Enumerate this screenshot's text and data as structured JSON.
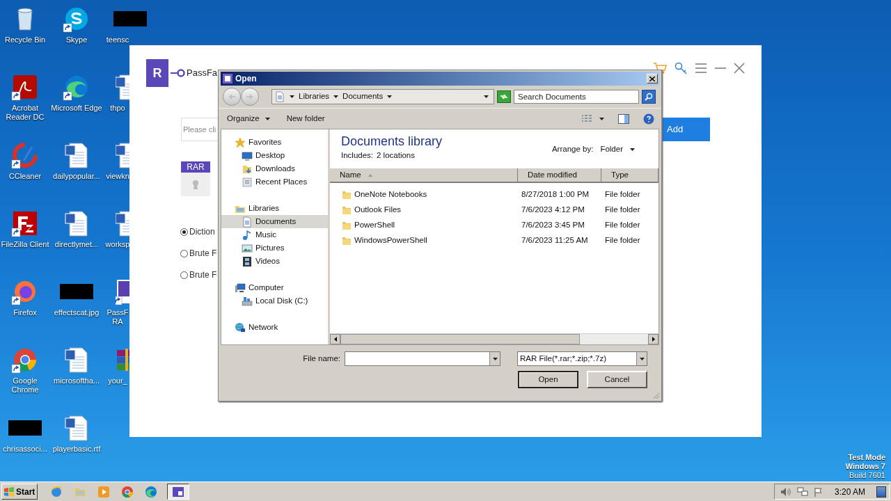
{
  "desktop": {
    "icon_columns": [
      [
        {
          "label": "Recycle Bin",
          "kind": "recycle",
          "shortcut": false
        },
        {
          "label": "Acrobat Reader DC",
          "kind": "acrobat",
          "shortcut": true
        },
        {
          "label": "CCleaner",
          "kind": "ccleaner",
          "shortcut": true
        },
        {
          "label": "FileZilla Client",
          "kind": "filezilla",
          "shortcut": true
        },
        {
          "label": "Firefox",
          "kind": "firefox",
          "shortcut": true
        },
        {
          "label": "Google Chrome",
          "kind": "chrome",
          "shortcut": true
        },
        {
          "label": "chrisassoci...",
          "kind": "redacted",
          "shortcut": false
        }
      ],
      [
        {
          "label": "Skype",
          "kind": "skype",
          "shortcut": true
        },
        {
          "label": "Microsoft Edge",
          "kind": "edge",
          "shortcut": true
        },
        {
          "label": "dailypopular...",
          "kind": "word",
          "shortcut": false
        },
        {
          "label": "directlymet...",
          "kind": "word",
          "shortcut": false
        },
        {
          "label": "effectscat.jpg",
          "kind": "redacted",
          "shortcut": false
        },
        {
          "label": "microsoftha...",
          "kind": "word",
          "shortcut": false
        },
        {
          "label": "playerbasic.rtf",
          "kind": "word",
          "shortcut": false
        }
      ],
      [
        {
          "label": "teensc",
          "kind": "redacted",
          "shortcut": false
        },
        {
          "label": "thpo",
          "kind": "word",
          "shortcut": false
        },
        {
          "label": "viewkn",
          "kind": "word",
          "shortcut": false
        },
        {
          "label": "worksp",
          "kind": "word",
          "shortcut": false
        },
        {
          "label": "PassF RA",
          "kind": "passfab",
          "shortcut": true
        },
        {
          "label": "your_",
          "kind": "winrar",
          "shortcut": false
        }
      ]
    ],
    "os_notice": [
      "Test Mode",
      "Windows 7",
      "Build 7601"
    ]
  },
  "app_window": {
    "logo_letter": "R",
    "title": "PassFa",
    "file_field": {
      "placeholder": "Please cli"
    },
    "add_button": "Add",
    "file_badge": "RAR",
    "attack_modes": [
      {
        "label": "Diction",
        "selected": true
      },
      {
        "label": "Brute F",
        "selected": false
      },
      {
        "label": "Brute F",
        "selected": false
      }
    ]
  },
  "dialog": {
    "title": "Open",
    "breadcrumb": [
      "Libraries",
      "Documents"
    ],
    "search": {
      "placeholder": "Search Documents"
    },
    "toolbar": [
      {
        "label": "Organize",
        "has_menu": true
      },
      {
        "label": "New folder",
        "has_menu": false
      }
    ],
    "nav": [
      {
        "label": "Favorites",
        "kind": "star",
        "selected": false,
        "children": [
          {
            "label": "Desktop",
            "kind": "desktop",
            "selected": false
          },
          {
            "label": "Downloads",
            "kind": "downloads",
            "selected": false
          },
          {
            "label": "Recent Places",
            "kind": "recent",
            "selected": false
          }
        ]
      },
      {
        "label": "Libraries",
        "kind": "library",
        "selected": false,
        "children": [
          {
            "label": "Documents",
            "kind": "document",
            "selected": true
          },
          {
            "label": "Music",
            "kind": "music",
            "selected": false
          },
          {
            "label": "Pictures",
            "kind": "pictures",
            "selected": false
          },
          {
            "label": "Videos",
            "kind": "videos",
            "selected": false
          }
        ]
      },
      {
        "label": "Computer",
        "kind": "computer",
        "selected": false,
        "children": [
          {
            "label": "Local Disk (C:)",
            "kind": "disk",
            "selected": false
          }
        ]
      },
      {
        "label": "Network",
        "kind": "network",
        "selected": false
      }
    ],
    "library_title": "Documents library",
    "includes_label": "Includes:",
    "includes_value": "2 locations",
    "arrange_label": "Arrange by:",
    "arrange_value": "Folder",
    "columns": [
      "Name",
      "Date modified",
      "Type"
    ],
    "rows": [
      {
        "name": "OneNote Notebooks",
        "date": "8/27/2018 1:00 PM",
        "type": "File folder"
      },
      {
        "name": "Outlook Files",
        "date": "7/6/2023 4:12 PM",
        "type": "File folder"
      },
      {
        "name": "PowerShell",
        "date": "7/6/2023 3:45 PM",
        "type": "File folder"
      },
      {
        "name": "WindowsPowerShell",
        "date": "7/6/2023 11:25 AM",
        "type": "File folder"
      }
    ],
    "file_name_label": "File name:",
    "file_type": "RAR File(*.rar;*.zip;*.7z)",
    "buttons": [
      {
        "label": "Open",
        "default": true
      },
      {
        "label": "Cancel",
        "default": false
      }
    ]
  },
  "taskbar": {
    "start": "Start",
    "apps": [
      {
        "kind": "ie",
        "active": false
      },
      {
        "kind": "explorer",
        "active": false
      },
      {
        "kind": "media",
        "active": false
      },
      {
        "kind": "chrome",
        "active": false
      },
      {
        "kind": "edge",
        "active": false
      },
      {
        "kind": "passfab",
        "active": true
      }
    ],
    "clock": "3:20 AM"
  }
}
